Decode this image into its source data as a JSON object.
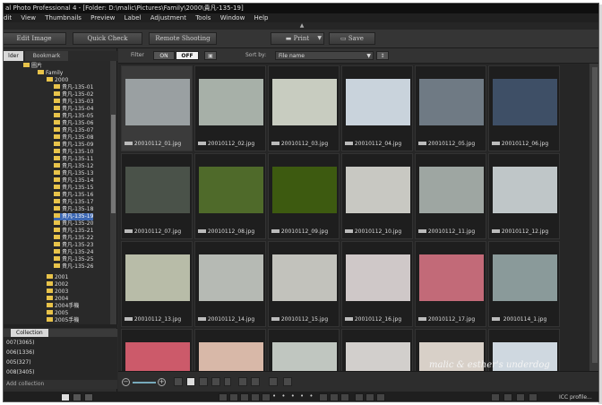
{
  "window": {
    "title": "al Photo Professional 4 - [Folder: D:\\malic\\Pictures\\Family\\2000\\貴凡-135-19]"
  },
  "menu": [
    "dit",
    "View",
    "Thumbnails",
    "Preview",
    "Label",
    "Adjustment",
    "Tools",
    "Window",
    "Help"
  ],
  "toolbar": {
    "edit_image": "Edit Image",
    "quick_check": "Quick Check",
    "remote_shooting": "Remote Shooting",
    "print": "Print",
    "save": "Save"
  },
  "left_tabs": {
    "folder": "lder",
    "bookmark": "Bookmark"
  },
  "tree": {
    "root": "圖片",
    "family": "Family",
    "year2000": "2000",
    "items": [
      "貴凡-135-01",
      "貴凡-135-02",
      "貴凡-135-03",
      "貴凡-135-04",
      "貴凡-135-05",
      "貴凡-135-06",
      "貴凡-135-07",
      "貴凡-135-08",
      "貴凡-135-09",
      "貴凡-135-10",
      "貴凡-135-11",
      "貴凡-135-12",
      "貴凡-135-13",
      "貴凡-135-14",
      "貴凡-135-15",
      "貴凡-135-16",
      "貴凡-135-17",
      "貴凡-135-18",
      "貴凡-135-19",
      "貴凡-135-20",
      "貴凡-135-21",
      "貴凡-135-22",
      "貴凡-135-23",
      "貴凡-135-24",
      "貴凡-135-25",
      "貴凡-135-26"
    ],
    "selected_index": 18,
    "years": [
      "2001",
      "2002",
      "2003",
      "2004",
      "2004手機",
      "2005",
      "2005手機"
    ]
  },
  "collection": {
    "tab": "Collection",
    "items": [
      "007(3065)",
      "006(1336)",
      "005(327)",
      "008(3405)"
    ],
    "add": "Add collection"
  },
  "filter": {
    "filter_label": "Filter",
    "on": "ON",
    "off": "OFF",
    "sort_label": "Sort by:",
    "sort_value": "File name"
  },
  "thumbnails": [
    {
      "name": "20010112_01.jpg",
      "bg": "#9aa0a2"
    },
    {
      "name": "20010112_02.jpg",
      "bg": "#a7b0a8"
    },
    {
      "name": "20010112_03.jpg",
      "bg": "#c8ccc0"
    },
    {
      "name": "20010112_04.jpg",
      "bg": "#c9d3dc"
    },
    {
      "name": "20010112_05.jpg",
      "bg": "#6f7a84"
    },
    {
      "name": "20010112_06.jpg",
      "bg": "#3e4f66"
    },
    {
      "name": "20010112_07.jpg",
      "bg": "#4a5249"
    },
    {
      "name": "20010112_08.jpg",
      "bg": "#4f6a2a"
    },
    {
      "name": "20010112_09.jpg",
      "bg": "#3d5a10"
    },
    {
      "name": "20010112_10.jpg",
      "bg": "#c8c8c2"
    },
    {
      "name": "20010112_11.jpg",
      "bg": "#9ea6a2"
    },
    {
      "name": "20010112_12.jpg",
      "bg": "#bfc6c8"
    },
    {
      "name": "20010112_13.jpg",
      "bg": "#b8bca8"
    },
    {
      "name": "20010112_14.jpg",
      "bg": "#b6bab4"
    },
    {
      "name": "20010112_15.jpg",
      "bg": "#c2c2bc"
    },
    {
      "name": "20010112_16.jpg",
      "bg": "#cfc8c8"
    },
    {
      "name": "20010112_17.jpg",
      "bg": "#c26a78"
    },
    {
      "name": "20010114_1.jpg",
      "bg": "#8a9a9a"
    },
    {
      "name": "",
      "bg": "#cc5a6a"
    },
    {
      "name": "",
      "bg": "#d8b8a8"
    },
    {
      "name": "",
      "bg": "#c0c6c0"
    },
    {
      "name": "",
      "bg": "#d2cfcc"
    },
    {
      "name": "",
      "bg": "#d8d0c8"
    },
    {
      "name": "",
      "bg": "#cfd8e0"
    }
  ],
  "watermark": "malic & esther's underdog",
  "status": {
    "icc": "ICC profile..."
  }
}
